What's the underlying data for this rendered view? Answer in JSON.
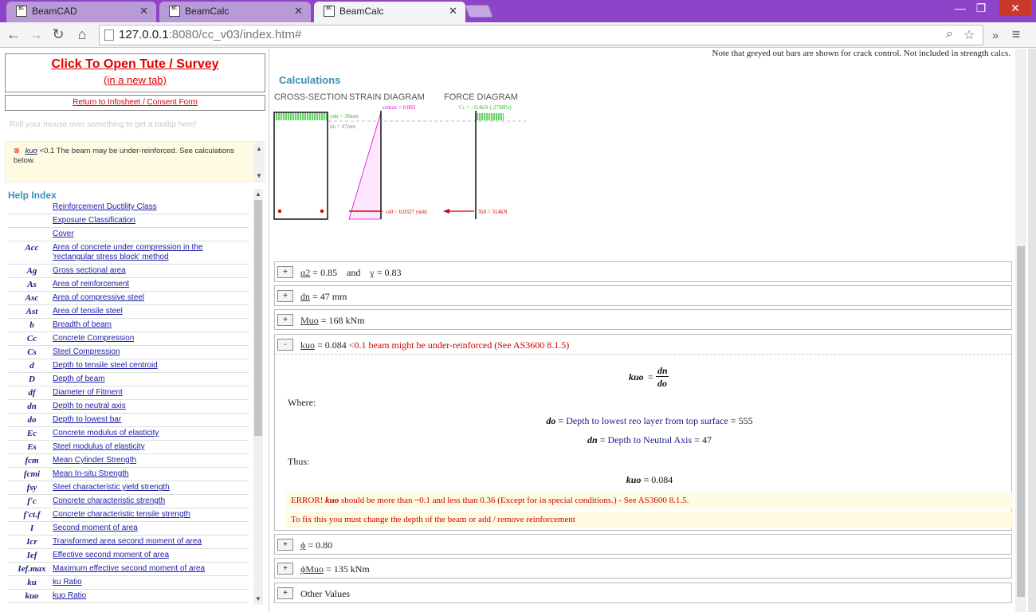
{
  "tabs": [
    {
      "label": "BeamCAD",
      "favicon": "BC"
    },
    {
      "label": "BeamCalc",
      "favicon": "BC"
    },
    {
      "label": "BeamCalc",
      "favicon": "BC"
    }
  ],
  "window_controls": {
    "minimize": "—",
    "maximize": "❐",
    "close": "✕"
  },
  "address": {
    "host": "127.0.0.1",
    "rest": ":8080/cc_v03/index.htm#"
  },
  "left": {
    "tute_line1": "Click To Open Tute / Survey",
    "tute_line2": "(in a new tab)",
    "consent_link": "Return to Infosheet / Consent Form",
    "tooltip_hint": "Roll your mouse over something to get a tooltip here!",
    "alert_symbol": "kuo",
    "alert_text": "<0.1 The beam may be under-reinforced. See calculations below.",
    "help_title": "Help Index",
    "help_items": [
      {
        "sym": "",
        "label": "Reinforcement Ductility Class"
      },
      {
        "sym": "",
        "label": "Exposure Classification"
      },
      {
        "sym": "",
        "label": "Cover"
      },
      {
        "sym": "Acc",
        "label": "Area of concrete under compression in the 'rectangular stress block' method"
      },
      {
        "sym": "Ag",
        "label": "Gross sectional area"
      },
      {
        "sym": "As",
        "label": "Area of reinforcement"
      },
      {
        "sym": "Asc",
        "label": "Area of compressive steel"
      },
      {
        "sym": "Ast",
        "label": "Area of tensile steel"
      },
      {
        "sym": "b",
        "label": "Breadth of beam"
      },
      {
        "sym": "Cc",
        "label": "Concrete Compression"
      },
      {
        "sym": "Cs",
        "label": "Steel Compression"
      },
      {
        "sym": "d",
        "label": "Depth to tensile steel centroid"
      },
      {
        "sym": "D",
        "label": "Depth of beam"
      },
      {
        "sym": "df",
        "label": "Diameter of Fitment"
      },
      {
        "sym": "dn",
        "label": "Depth to neutral axis"
      },
      {
        "sym": "do",
        "label": "Depth to lowest bar"
      },
      {
        "sym": "Ec",
        "label": "Concrete modulus of elasticity"
      },
      {
        "sym": "Es",
        "label": "Steel modulus of elasticity"
      },
      {
        "sym": "fcm",
        "label": "Mean Cylinder Strength"
      },
      {
        "sym": "fcmi",
        "label": "Mean In-situ Strength"
      },
      {
        "sym": "fsy",
        "label": "Steel characteristic yield strength"
      },
      {
        "sym": "f'c",
        "label": "Concrete characteristic strength"
      },
      {
        "sym": "f'ct.f",
        "label": "Concrete characteristic tensile strength"
      },
      {
        "sym": "I",
        "label": "Second moment of area"
      },
      {
        "sym": "Icr",
        "label": "Transformed area second moment of area"
      },
      {
        "sym": "Ief",
        "label": "Effective second moment of area"
      },
      {
        "sym": "Ief.max",
        "label": "Maximum effective second moment of area"
      },
      {
        "sym": "ku",
        "label": "ku Ratio"
      },
      {
        "sym": "kuo",
        "label": "kuo Ratio"
      }
    ]
  },
  "content": {
    "note": "Note that greyed out bars are shown for crack control. Not included in strength calcs.",
    "calc_title": "Calculations",
    "diagram_labels": {
      "cross": "CROSS-SECTION",
      "strain": "STRAIN DIAGRAM",
      "force": "FORCE DIAGRAM"
    },
    "diagram_text": {
      "ydn": "ydn = 38mm",
      "dn": "dn = 47mm",
      "ecmax": "εcmax = 0.003",
      "cc": "Cc = -314kN (-27MPa)",
      "es0": "εs0 = 0.0327 yield",
      "ts0": "Ts0 = 314kN"
    },
    "rows": {
      "alpha": {
        "btn": "+",
        "sym1": "α2",
        "val1": " = 0.85",
        "and": "and",
        "sym2": "γ",
        "val2": " = 0.83"
      },
      "dn": {
        "btn": "+",
        "sym": "dn",
        "val": " = 47 mm"
      },
      "muo": {
        "btn": "+",
        "sym": "Muo",
        "val": " = 168 kNm"
      },
      "kuo": {
        "btn": "-",
        "sym": "kuo",
        "val": " = 0.084 ",
        "warn": "<0.1 beam might be under-reinforced (See AS3600 8.1.5)"
      },
      "phi": {
        "btn": "+",
        "sym": "ϕ",
        "val": " = 0.80"
      },
      "phimuo": {
        "btn": "+",
        "sym": "ϕMuo",
        "val": " = 135 kNm"
      },
      "other": {
        "btn": "+",
        "label": "Other Values"
      }
    },
    "expanded": {
      "formula_lhs": "kuo",
      "formula_num": "dn",
      "formula_den": "do",
      "where": "Where:",
      "do_sym": "do",
      "do_desc": "Depth to lowest reo layer from top surface",
      "do_val": "555",
      "dn_sym": "dn",
      "dn_desc": "Depth to Neutral Axis",
      "dn_val": "47",
      "thus": "Thus:",
      "result_sym": "kuo",
      "result_val": "0.084",
      "error_prefix": "ERROR!",
      "error_sym": "kuo",
      "error_text": "should be more than ~0.1 and less than 0.36 (Except for in special conditions.) - See AS3600 8.1.5.",
      "fix_text": "To fix this you must change the depth of the beam or add / remove reinforcement"
    }
  }
}
